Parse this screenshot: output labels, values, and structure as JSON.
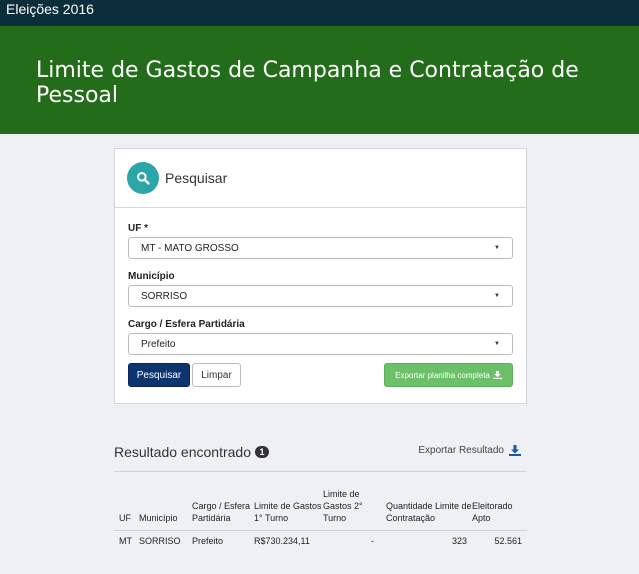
{
  "topbar": {
    "title": "Eleições 2016"
  },
  "hero": {
    "title": "Limite de Gastos de Campanha e Contratação de Pessoal"
  },
  "search_panel": {
    "title": "Pesquisar",
    "fields": {
      "uf": {
        "label": "UF *",
        "value": "MT - MATO GROSSO"
      },
      "municipio": {
        "label": "Município",
        "value": "SORRISO"
      },
      "cargo": {
        "label": "Cargo / Esfera Partidária",
        "value": "Prefeito"
      }
    },
    "buttons": {
      "search": "Pesquisar",
      "clear": "Limpar",
      "export_full": "Exportar planilha completa"
    }
  },
  "results": {
    "title": "Resultado encontrado",
    "count": "1",
    "export_label": "Exportar Resultado",
    "columns": [
      "UF",
      "Município",
      "Cargo / Esfera Partidária",
      "Limite de Gastos 1° Turno",
      "Limite de Gastos 2° Turno",
      "Quantidade Limite de Contratação",
      "Eleitorado Apto"
    ],
    "rows": [
      [
        "MT",
        "SORRISO",
        "Prefeito",
        "R$730.234,11",
        "-",
        "323",
        "52.561"
      ]
    ]
  },
  "colors": {
    "topbar": "#0c2d3a",
    "hero": "#236c1a",
    "primary_button": "#0e3470",
    "export_button": "#6cc069",
    "search_icon_bg": "#2ca5a8"
  }
}
